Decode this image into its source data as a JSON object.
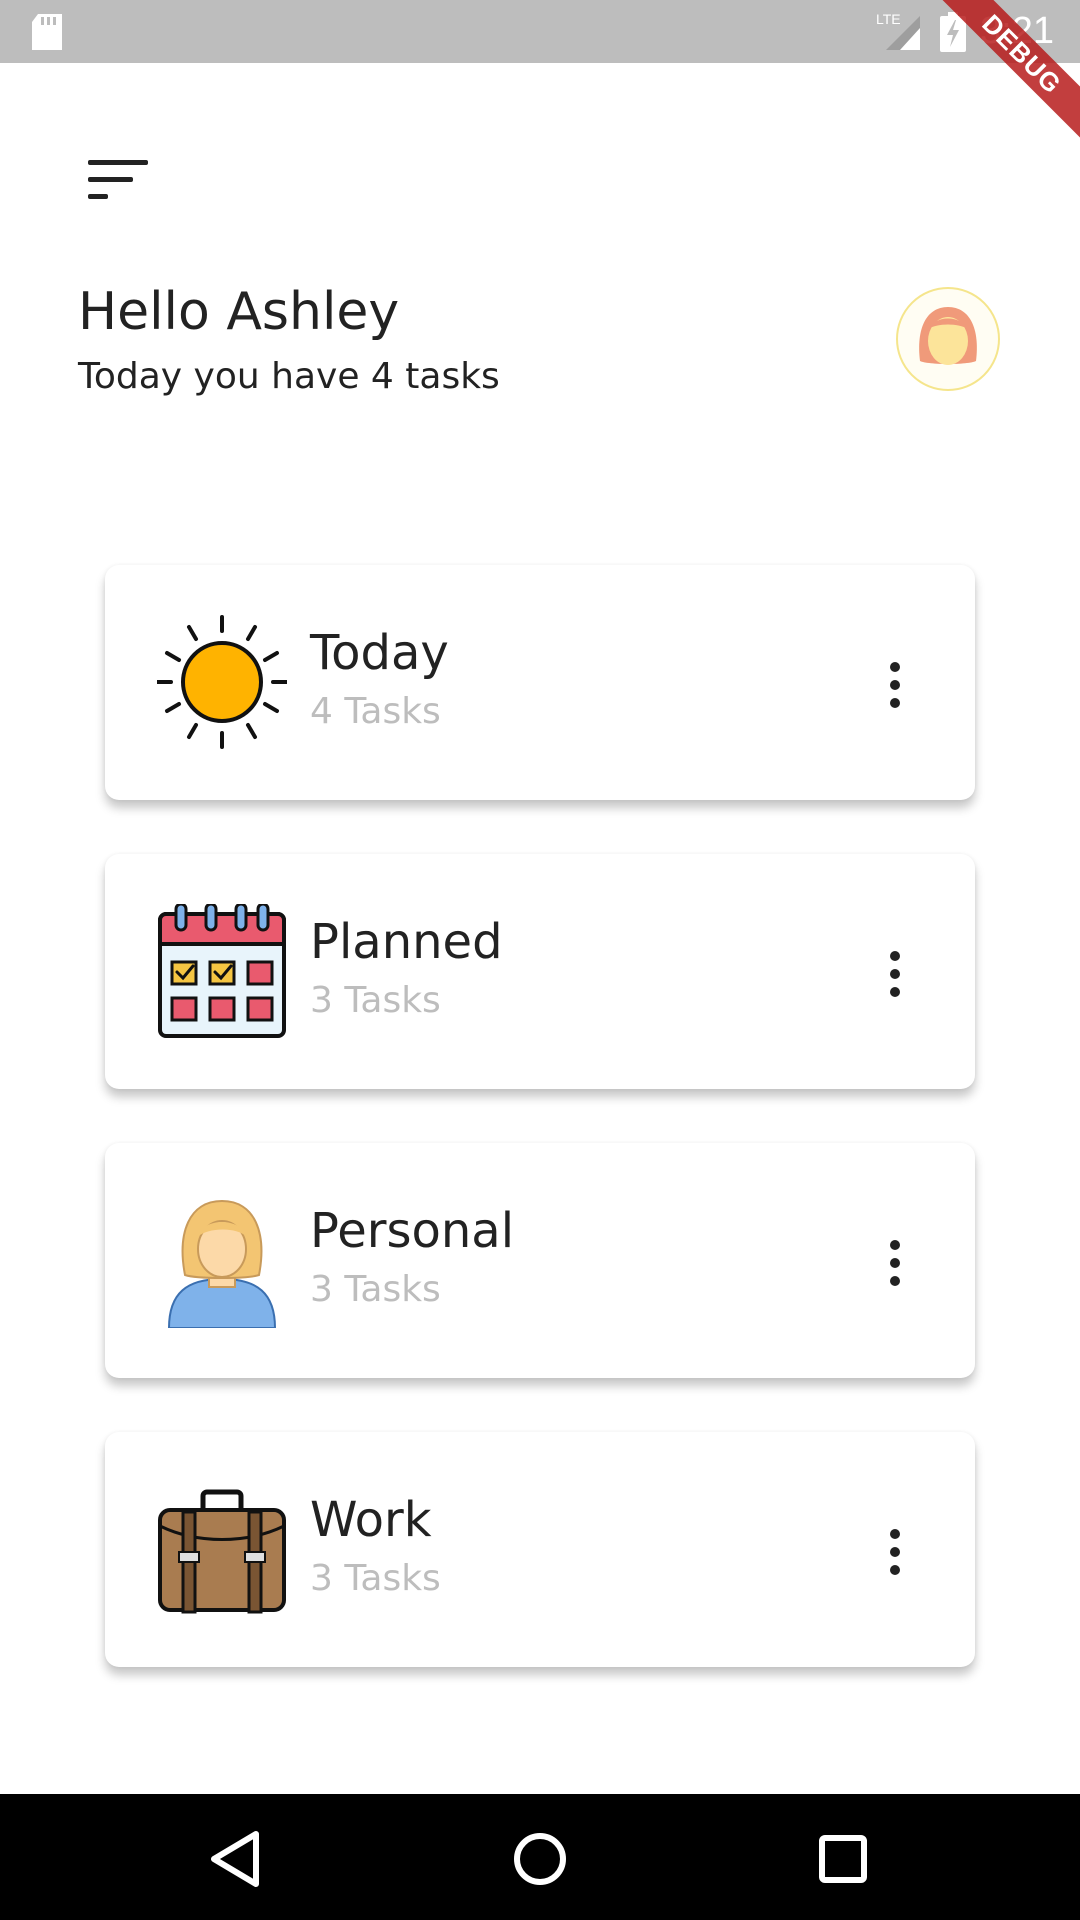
{
  "status_bar": {
    "time": "3:21",
    "network": "LTE",
    "debug_banner": "DEBUG"
  },
  "header": {
    "greeting": "Hello Ashley",
    "subtitle": "Today you have 4 tasks"
  },
  "categories": [
    {
      "title": "Today",
      "count": "4 Tasks",
      "icon": "sun-icon"
    },
    {
      "title": "Planned",
      "count": "3 Tasks",
      "icon": "calendar-icon"
    },
    {
      "title": "Personal",
      "count": "3 Tasks",
      "icon": "person-icon"
    },
    {
      "title": "Work",
      "count": "3 Tasks",
      "icon": "briefcase-icon"
    }
  ],
  "colors": {
    "sun": "#FFB300",
    "calendar_header": "#E95A6E",
    "calendar_check": "#F5C542",
    "person_hair": "#F3C572",
    "person_shirt": "#7FB2EA",
    "briefcase": "#A97C50",
    "debug_ribbon": "#B71C1C"
  }
}
